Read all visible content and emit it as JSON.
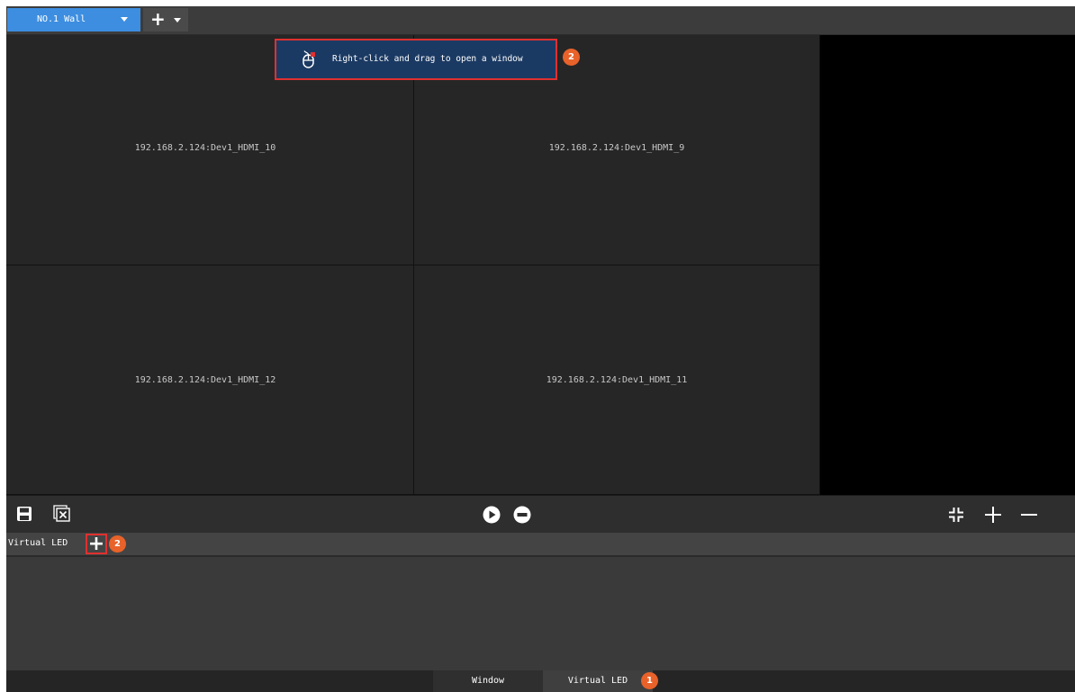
{
  "topbar": {
    "wall_tab_label": "NO.1 Wall",
    "add_tab_symbol": "+"
  },
  "wall": {
    "cells": [
      {
        "label": "192.168.2.124:Dev1_HDMI_10"
      },
      {
        "label": "192.168.2.124:Dev1_HDMI_9"
      },
      {
        "label": "192.168.2.124:Dev1_HDMI_12"
      },
      {
        "label": "192.168.2.124:Dev1_HDMI_11"
      }
    ]
  },
  "hint": {
    "text": "Right-click and drag to open a window",
    "badge": "2",
    "icon": "mouse-icon"
  },
  "toolbar": {
    "left_icons": [
      "save-icon",
      "close-all-icon"
    ],
    "center_icons": [
      "play-icon",
      "stop-icon"
    ],
    "right_icons": [
      "fit-icon",
      "zoom-in-icon",
      "zoom-out-icon"
    ]
  },
  "virtual_led": {
    "label": "Virtual LED",
    "add_symbol": "+",
    "badge": "2"
  },
  "bottom_tabs": {
    "window_label": "Window",
    "virtual_led_label": "Virtual LED",
    "badge": "1"
  },
  "colors": {
    "accent": "#3d8ee0",
    "badge": "#e8622a",
    "highlight_border": "#e03030",
    "hint_bg": "#1b3a63"
  }
}
